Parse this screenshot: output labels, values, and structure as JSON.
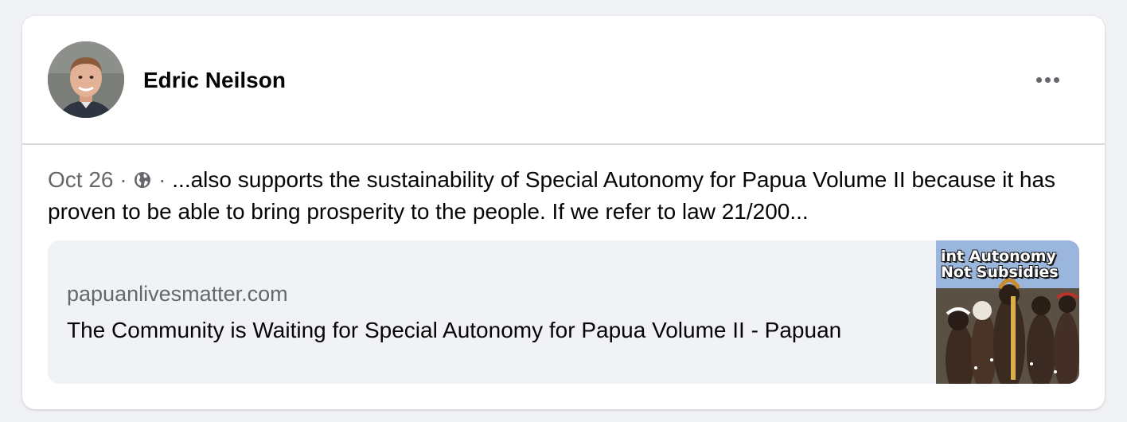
{
  "post": {
    "author": "Edric Neilson",
    "date": "Oct 26",
    "separator": "·",
    "privacy_icon": "globe-icon",
    "text": "...also supports the sustainability of Special Autonomy for Papua Volume II because it has proven to be able to bring prosperity to the people. If we refer to law 21/200..."
  },
  "link_preview": {
    "domain": "papuanlivesmatter.com",
    "title": "The Community is Waiting for Special Autonomy for Papua Volume II - Papuan",
    "thumbnail_caption_line1": "int Autonomy",
    "thumbnail_caption_line2": "Not Subsidies"
  },
  "icons": {
    "more": "more-options-icon"
  }
}
